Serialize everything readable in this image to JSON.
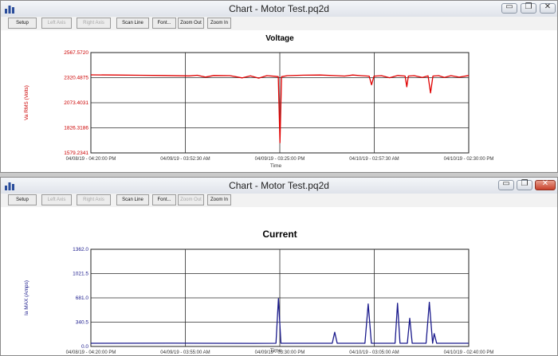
{
  "windows": [
    {
      "title": "Chart - Motor Test.pq2d",
      "toolbar": [
        {
          "label": "Setup",
          "enabled": true
        },
        {
          "label": "Left Axis",
          "enabled": false
        },
        {
          "label": "Right Axis",
          "enabled": false
        },
        {
          "label": "Scan Line",
          "enabled": true
        },
        {
          "label": "Font...",
          "enabled": true
        },
        {
          "label": "Zoom Out",
          "enabled": true
        },
        {
          "label": "Zoom In",
          "enabled": true
        }
      ],
      "controls": {
        "minimize": "▭",
        "restore": "❐",
        "close": "✕"
      },
      "chart_data": {
        "type": "line",
        "title": "Voltage",
        "ylabel": "Va RMS (Volts)",
        "xlabel": "Time",
        "color": "#e00000",
        "ylim": [
          1579.2341,
          2567.572
        ],
        "ytick_labels": [
          "2567.5720",
          "2320.4875",
          "2073.4031",
          "1826.3186",
          "1579.2341"
        ],
        "xtick_labels": [
          "04/08/19 - 04:20:00 PM",
          "04/09/19 - 03:52:30 AM",
          "04/09/19 - 03:25:00 PM",
          "04/10/19 - 02:57:30 AM",
          "04/10/19 - 02:30:00 PM"
        ],
        "x_range_hours": [
          0,
          46.17
        ],
        "grid": true,
        "series": [
          {
            "values": [
              [
                0,
                2348
              ],
              [
                3,
                2346
              ],
              [
                6,
                2344
              ],
              [
                9,
                2342
              ],
              [
                12,
                2338
              ],
              [
                13,
                2344
              ],
              [
                14,
                2326
              ],
              [
                15,
                2342
              ],
              [
                17,
                2340
              ],
              [
                18.5,
                2318
              ],
              [
                19.5,
                2338
              ],
              [
                20.5,
                2316
              ],
              [
                21.5,
                2340
              ],
              [
                22.5,
                2334
              ],
              [
                22.9,
                2330
              ],
              [
                23.1,
                1680
              ],
              [
                23.3,
                2330
              ],
              [
                24,
                2340
              ],
              [
                26,
                2345
              ],
              [
                28,
                2346
              ],
              [
                30,
                2340
              ],
              [
                31,
                2336
              ],
              [
                32,
                2346
              ],
              [
                33,
                2340
              ],
              [
                34,
                2335
              ],
              [
                34.3,
                2250
              ],
              [
                34.6,
                2335
              ],
              [
                35.5,
                2340
              ],
              [
                36.5,
                2320
              ],
              [
                37.5,
                2342
              ],
              [
                38.4,
                2336
              ],
              [
                38.6,
                2230
              ],
              [
                38.8,
                2336
              ],
              [
                39.5,
                2340
              ],
              [
                40.5,
                2322
              ],
              [
                41.2,
                2338
              ],
              [
                41.5,
                2170
              ],
              [
                41.8,
                2336
              ],
              [
                42.5,
                2340
              ],
              [
                43.2,
                2322
              ],
              [
                44,
                2340
              ],
              [
                45,
                2325
              ],
              [
                46.17,
                2342
              ]
            ]
          }
        ]
      }
    },
    {
      "title": "Chart - Motor Test.pq2d",
      "toolbar": [
        {
          "label": "Setup",
          "enabled": true
        },
        {
          "label": "Left Axis",
          "enabled": false
        },
        {
          "label": "Right Axis",
          "enabled": false
        },
        {
          "label": "Scan Line",
          "enabled": true
        },
        {
          "label": "Font...",
          "enabled": true
        },
        {
          "label": "Zoom Out",
          "enabled": false
        },
        {
          "label": "Zoom In",
          "enabled": true
        }
      ],
      "controls": {
        "minimize": "▭",
        "restore": "❐",
        "close": "✕"
      },
      "chart_data": {
        "type": "line",
        "title": "Current",
        "ylabel": "Ia MAX (Amps)",
        "xlabel": "Time",
        "color": "#1a1a8c",
        "ylim": [
          0,
          1362.0
        ],
        "ytick_labels": [
          "1362.0",
          "1021.5",
          "681.0",
          "340.5",
          "0.0"
        ],
        "xtick_labels": [
          "04/08/19 - 04:20:00 PM",
          "04/09/19 - 03:55:00 AM",
          "04/09/19 - 03:30:00 PM",
          "04/10/19 - 03:05:00 AM",
          "04/10/19 - 02:40:00 PM"
        ],
        "x_range_hours": [
          0,
          46.33
        ],
        "grid": true,
        "series": [
          {
            "values": [
              [
                0,
                45
              ],
              [
                10,
                46
              ],
              [
                20,
                44
              ],
              [
                22.7,
                45
              ],
              [
                23.0,
                670
              ],
              [
                23.3,
                45
              ],
              [
                28,
                45
              ],
              [
                29.6,
                45
              ],
              [
                29.9,
                200
              ],
              [
                30.2,
                45
              ],
              [
                33.6,
                45
              ],
              [
                34.0,
                595
              ],
              [
                34.4,
                45
              ],
              [
                37.3,
                45
              ],
              [
                37.6,
                605
              ],
              [
                37.9,
                45
              ],
              [
                38.8,
                45
              ],
              [
                39.1,
                395
              ],
              [
                39.4,
                45
              ],
              [
                41.1,
                45
              ],
              [
                41.5,
                620
              ],
              [
                41.9,
                45
              ],
              [
                42.1,
                180
              ],
              [
                42.4,
                45
              ],
              [
                46.33,
                45
              ]
            ]
          }
        ]
      }
    }
  ]
}
